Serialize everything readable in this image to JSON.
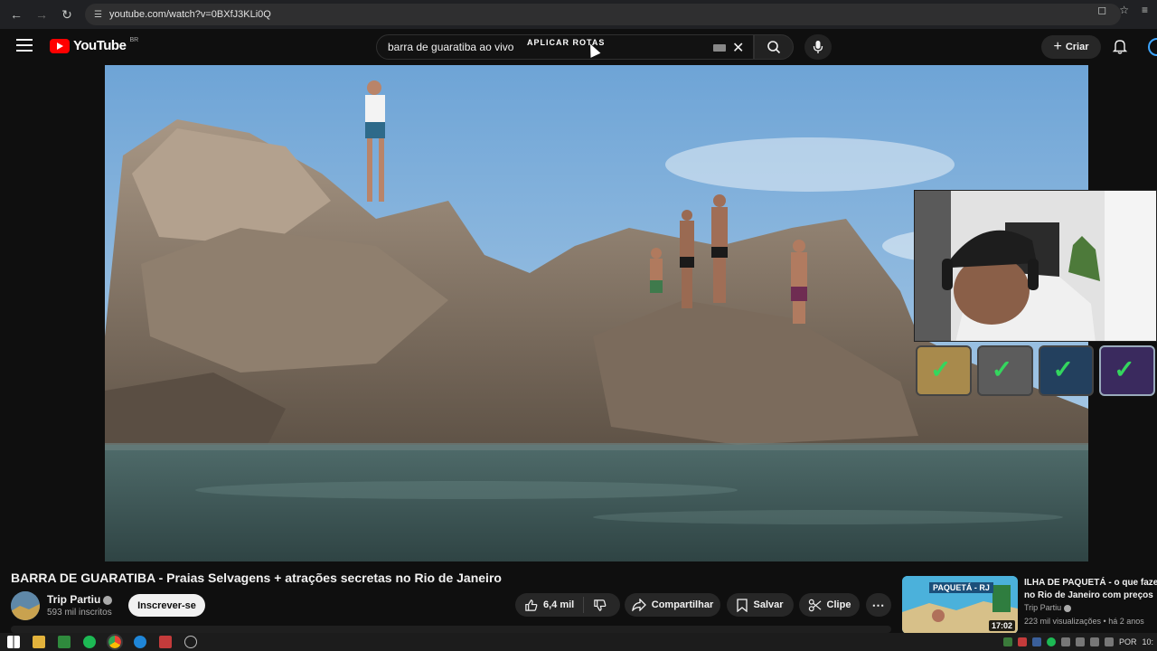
{
  "browser": {
    "url": "youtube.com/watch?v=0BXfJ3KLi0Q",
    "nav": [
      "back-icon",
      "forward-icon",
      "reload-icon",
      "site-info-icon"
    ]
  },
  "header": {
    "logo_text": "YouTube",
    "country": "BR",
    "search_value": "barra de guaratiba ao vivo",
    "search_overlay": "APLICAR ROTAS",
    "create_label": "Criar"
  },
  "video": {
    "title": "BARRA DE GUARATIBA - Praias Selvagens + atrações secretas no Rio de Janeiro",
    "channel": {
      "name": "Trip Partiu",
      "subscribers": "593 mil inscritos"
    },
    "subscribe_label": "Inscrever-se",
    "actions": {
      "likes": "6,4 mil",
      "share": "Compartilhar",
      "save": "Salvar",
      "clip": "Clipe"
    }
  },
  "recommended": {
    "thumb_label": "PAQUETÁ - RJ",
    "duration": "17:02",
    "title_line1": "ILHA DE PAQUETÁ - o que faze",
    "title_line2": "no Rio de Janeiro com preços",
    "channel": "Trip Partiu",
    "meta": "223 mil visualizações • há 2 anos"
  },
  "taskbar": {
    "language": "POR",
    "clock": "10:"
  },
  "colors": {
    "yt_red": "#ff0000",
    "background": "#0f0f0f",
    "check_green": "#34d65e"
  }
}
